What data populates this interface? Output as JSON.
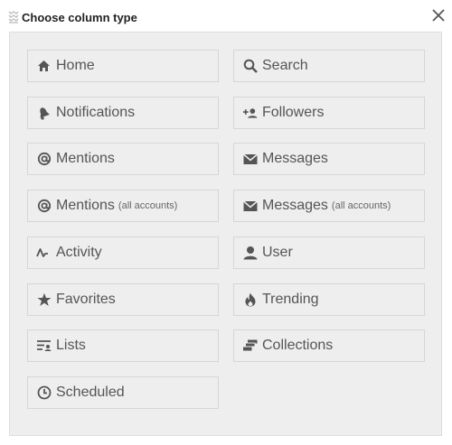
{
  "dialog": {
    "title": "Choose column type",
    "app_icon": "column-stack-icon",
    "close_icon": "close-icon"
  },
  "columns": [
    {
      "label": "Home",
      "sub": "",
      "icon": "home-icon"
    },
    {
      "label": "Search",
      "sub": "",
      "icon": "search-icon"
    },
    {
      "label": "Notifications",
      "sub": "",
      "icon": "bell-icon"
    },
    {
      "label": "Followers",
      "sub": "",
      "icon": "add-person-icon"
    },
    {
      "label": "Mentions",
      "sub": "",
      "icon": "at-icon"
    },
    {
      "label": "Messages",
      "sub": "",
      "icon": "envelope-icon"
    },
    {
      "label": "Mentions",
      "sub": "(all accounts)",
      "icon": "at-icon"
    },
    {
      "label": "Messages",
      "sub": "(all accounts)",
      "icon": "envelope-icon"
    },
    {
      "label": "Activity",
      "sub": "",
      "icon": "activity-icon"
    },
    {
      "label": "User",
      "sub": "",
      "icon": "user-icon"
    },
    {
      "label": "Favorites",
      "sub": "",
      "icon": "star-icon"
    },
    {
      "label": "Trending",
      "sub": "",
      "icon": "flame-icon"
    },
    {
      "label": "Lists",
      "sub": "",
      "icon": "list-icon"
    },
    {
      "label": "Collections",
      "sub": "",
      "icon": "collections-icon"
    },
    {
      "label": "Scheduled",
      "sub": "",
      "icon": "clock-icon"
    }
  ],
  "colors": {
    "panel_bg": "#eeeeee",
    "button_border": "#d6d6d6",
    "text": "#555555",
    "title_text": "#222222"
  }
}
